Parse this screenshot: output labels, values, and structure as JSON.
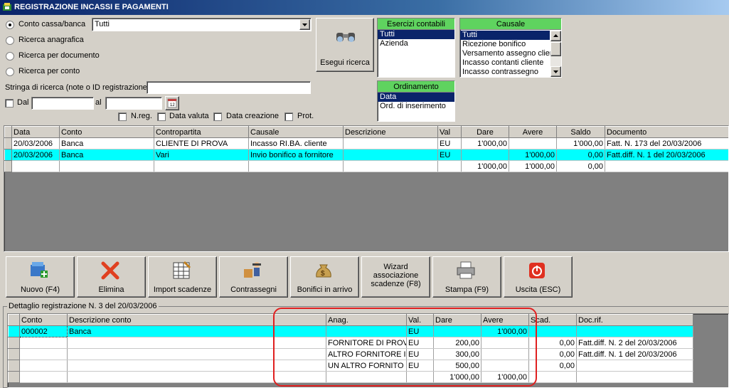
{
  "window": {
    "title": "REGISTRAZIONE INCASSI E PAGAMENTI"
  },
  "search": {
    "radios": [
      {
        "label": "Conto cassa/banca",
        "checked": true
      },
      {
        "label": "Ricerca anagrafica",
        "checked": false
      },
      {
        "label": "Ricerca per documento",
        "checked": false
      },
      {
        "label": "Ricerca per conto",
        "checked": false
      }
    ],
    "account_select_value": "Tutti",
    "search_string_label": "Stringa di ricerca (note o ID registrazione)",
    "search_string_value": "",
    "from_label": "Dal",
    "to_label": "al",
    "checkboxes": [
      "N.reg.",
      "Data valuta",
      "Data creazione",
      "Prot."
    ],
    "search_button_label": "Esegui ricerca"
  },
  "esercizi": {
    "header": "Esercizi contabili",
    "items": [
      "Tutti",
      "Azienda"
    ],
    "selected": 0
  },
  "ordinamento": {
    "header": "Ordinamento",
    "items": [
      "Data",
      "Ord. di inserimento"
    ],
    "selected": 0
  },
  "causale": {
    "header": "Causale",
    "items": [
      "Tutti",
      "Ricezione bonifico",
      "Versamento assegno clier",
      "Incasso contanti cliente",
      "Incasso contrassegno"
    ],
    "selected": 0
  },
  "main_table": {
    "columns": [
      "Data",
      "Conto",
      "Contropartita",
      "Causale",
      "Descrizione",
      "Val",
      "Dare",
      "Avere",
      "Saldo",
      "Documento"
    ],
    "rows": [
      [
        "20/03/2006",
        "Banca",
        "CLIENTE DI PROVA",
        "Incasso RI.BA. cliente",
        "",
        "EU",
        "1'000,00",
        "",
        "1'000,00",
        "Fatt. N. 173 del 20/03/2006"
      ],
      [
        "20/03/2006",
        "Banca",
        "Vari",
        "Invio bonifico a fornitore",
        "",
        "EU",
        "",
        "1'000,00",
        "0,00",
        "Fatt.diff. N. 1 del 20/03/2006"
      ],
      [
        "",
        "",
        "",
        "",
        "",
        "",
        "1'000,00",
        "1'000,00",
        "0,00",
        ""
      ]
    ],
    "highlighted_row": 1
  },
  "toolbar": [
    {
      "label": "Nuovo (F4)",
      "icon": "new-record-icon"
    },
    {
      "label": "Elimina",
      "icon": "delete-x-icon"
    },
    {
      "label": "Import scadenze",
      "icon": "spreadsheet-icon"
    },
    {
      "label": "Contrassegni",
      "icon": "delivery-person-icon"
    },
    {
      "label": "Bonifici in arrivo",
      "icon": "money-bag-icon"
    },
    {
      "label": "Wizard associazione scadenze (F8)",
      "icon": ""
    },
    {
      "label": "Stampa (F9)",
      "icon": "printer-icon"
    },
    {
      "label": "Uscita (ESC)",
      "icon": "power-icon"
    }
  ],
  "detail": {
    "group_label": "Dettaglio registrazione N. 3 del 20/03/2006",
    "columns": [
      "Conto",
      "Descrizione conto",
      "Anag.",
      "Val.",
      "Dare",
      "Avere",
      "Scad.",
      "Doc.rif."
    ],
    "rows": [
      [
        "000002",
        "Banca",
        "",
        "EU",
        "",
        "1'000,00",
        "",
        ""
      ],
      [
        "",
        "",
        "FORNITORE DI PROV",
        "EU",
        "200,00",
        "",
        "0,00",
        "Fatt.diff. N. 2 del 20/03/2006"
      ],
      [
        "",
        "",
        "ALTRO FORNITORE I",
        "EU",
        "300,00",
        "",
        "0,00",
        "Fatt.diff. N. 1 del 20/03/2006"
      ],
      [
        "",
        "",
        "UN ALTRO FORNITO",
        "EU",
        "500,00",
        "",
        "0,00",
        ""
      ],
      [
        "",
        "",
        "",
        "",
        "1'000,00",
        "1'000,00",
        "",
        ""
      ]
    ],
    "highlighted_row": 0
  }
}
